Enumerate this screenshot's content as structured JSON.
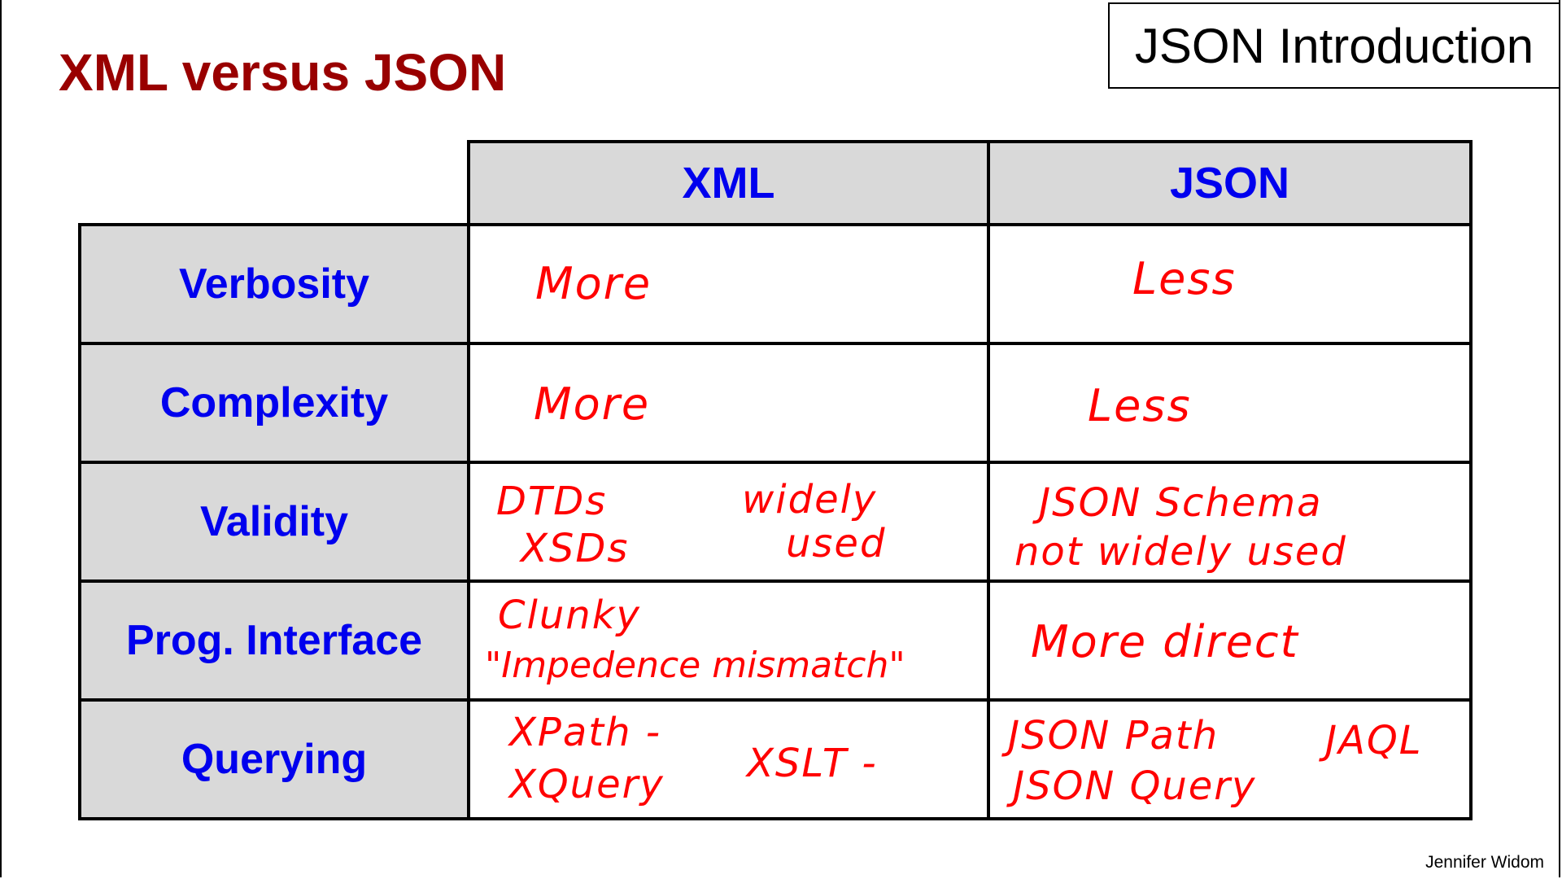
{
  "slide": {
    "title": "XML versus JSON",
    "topic": "JSON Introduction",
    "author": "Jennifer Widom"
  },
  "table": {
    "columns": [
      "XML",
      "JSON"
    ],
    "rows": [
      {
        "label": "Verbosity",
        "xml": [
          "More"
        ],
        "json": [
          "Less"
        ]
      },
      {
        "label": "Complexity",
        "xml": [
          "More"
        ],
        "json": [
          "Less"
        ]
      },
      {
        "label": "Validity",
        "xml": [
          "DTDs",
          "XSDs",
          "widely",
          "used"
        ],
        "json": [
          "JSON Schema",
          "not widely used"
        ]
      },
      {
        "label": "Prog. Interface",
        "xml": [
          "Clunky",
          "\"Impedence mismatch\""
        ],
        "json": [
          "More direct"
        ]
      },
      {
        "label": "Querying",
        "xml": [
          "XPath -",
          "XQuery",
          "XSLT -"
        ],
        "json": [
          "JSON Path",
          "JSON Query",
          "JAQL"
        ]
      }
    ]
  },
  "colors": {
    "title": "#990000",
    "header_text": "#0000ee",
    "handwriting": "#ff0000",
    "header_fill": "#d9d9d9"
  }
}
